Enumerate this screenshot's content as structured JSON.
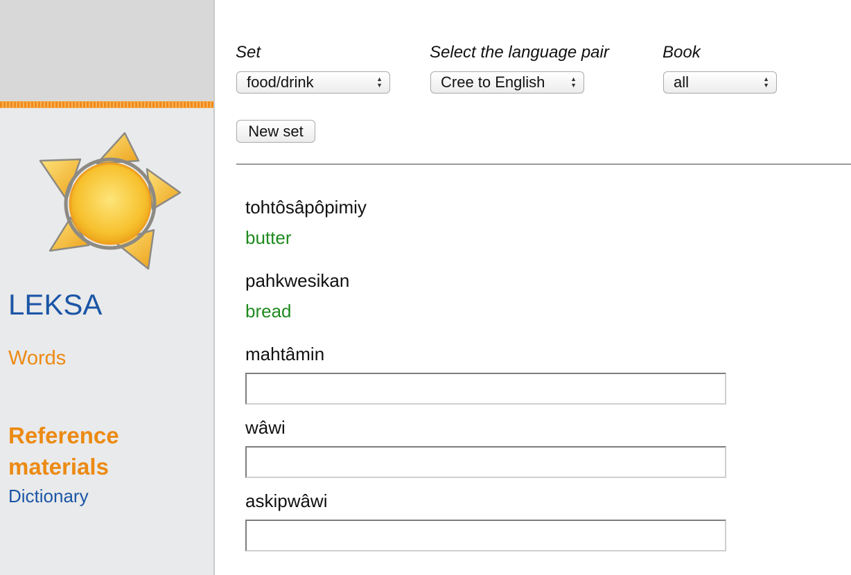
{
  "sidebar": {
    "app_title": "LEKSA",
    "nav_words": "Words",
    "reference_heading": "Reference materials",
    "nav_dictionary": "Dictionary"
  },
  "controls": {
    "set_label": "Set",
    "set_value": "food/drink",
    "pair_label": "Select the language pair",
    "pair_value": "Cree to English",
    "book_label": "Book",
    "book_value": "all",
    "new_set_button": "New set"
  },
  "exercise": {
    "items": [
      {
        "word": "tohtôsâpôpimiy",
        "answer": "butter"
      },
      {
        "word": "pahkwesikan",
        "answer": "bread"
      },
      {
        "word": "mahtâmin",
        "input_value": ""
      },
      {
        "word": "wâwi",
        "input_value": ""
      },
      {
        "word": "askipwâwi",
        "input_value": ""
      }
    ]
  },
  "colors": {
    "brand_blue": "#1a55a6",
    "accent_orange": "#ec8a13",
    "answer_green": "#1f8a1f"
  },
  "icons": {
    "logo": "sun-star-logo-icon",
    "select_arrows": "up-down-arrows-icon"
  }
}
